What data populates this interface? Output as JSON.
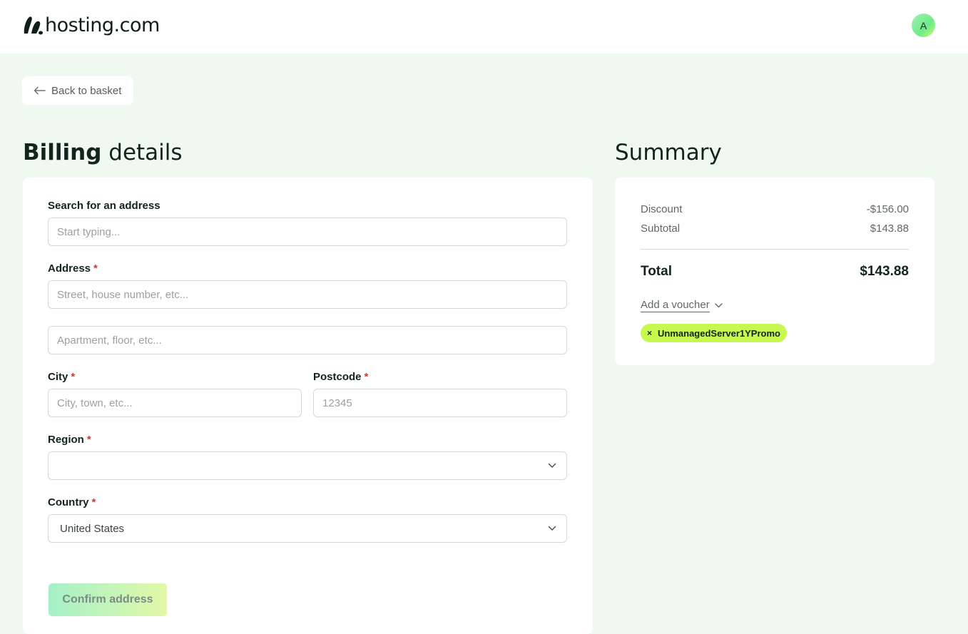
{
  "header": {
    "logo_text": "hosting.com",
    "avatar_initial": "A"
  },
  "nav": {
    "back_label": "Back to basket"
  },
  "billing": {
    "title_bold": "Billing",
    "title_light": "details",
    "search": {
      "label": "Search for an address",
      "placeholder": "Start typing..."
    },
    "address": {
      "label": "Address",
      "required_mark": "*",
      "line1_placeholder": "Street, house number, etc...",
      "line2_placeholder": "Apartment, floor, etc..."
    },
    "city": {
      "label": "City",
      "required_mark": "*",
      "placeholder": "City, town, etc..."
    },
    "postcode": {
      "label": "Postcode",
      "required_mark": "*",
      "placeholder": "12345"
    },
    "region": {
      "label": "Region",
      "required_mark": "*",
      "value": ""
    },
    "country": {
      "label": "Country",
      "required_mark": "*",
      "value": "United States"
    },
    "confirm_label": "Confirm address"
  },
  "summary": {
    "title": "Summary",
    "discount_label": "Discount",
    "discount_value": "-$156.00",
    "subtotal_label": "Subtotal",
    "subtotal_value": "$143.88",
    "total_label": "Total",
    "total_value": "$143.88",
    "voucher_label": "Add a voucher",
    "voucher_chip": "UnmanagedServer1YPromo",
    "voucher_remove": "×"
  },
  "icons": {
    "logo": "hosting-logo-icon",
    "back": "arrow-left-icon",
    "chevron": "chevron-down-icon"
  },
  "colors": {
    "page_bg": "#f0f9ef",
    "required": "#e0312f",
    "chip": "#c7f84f"
  }
}
